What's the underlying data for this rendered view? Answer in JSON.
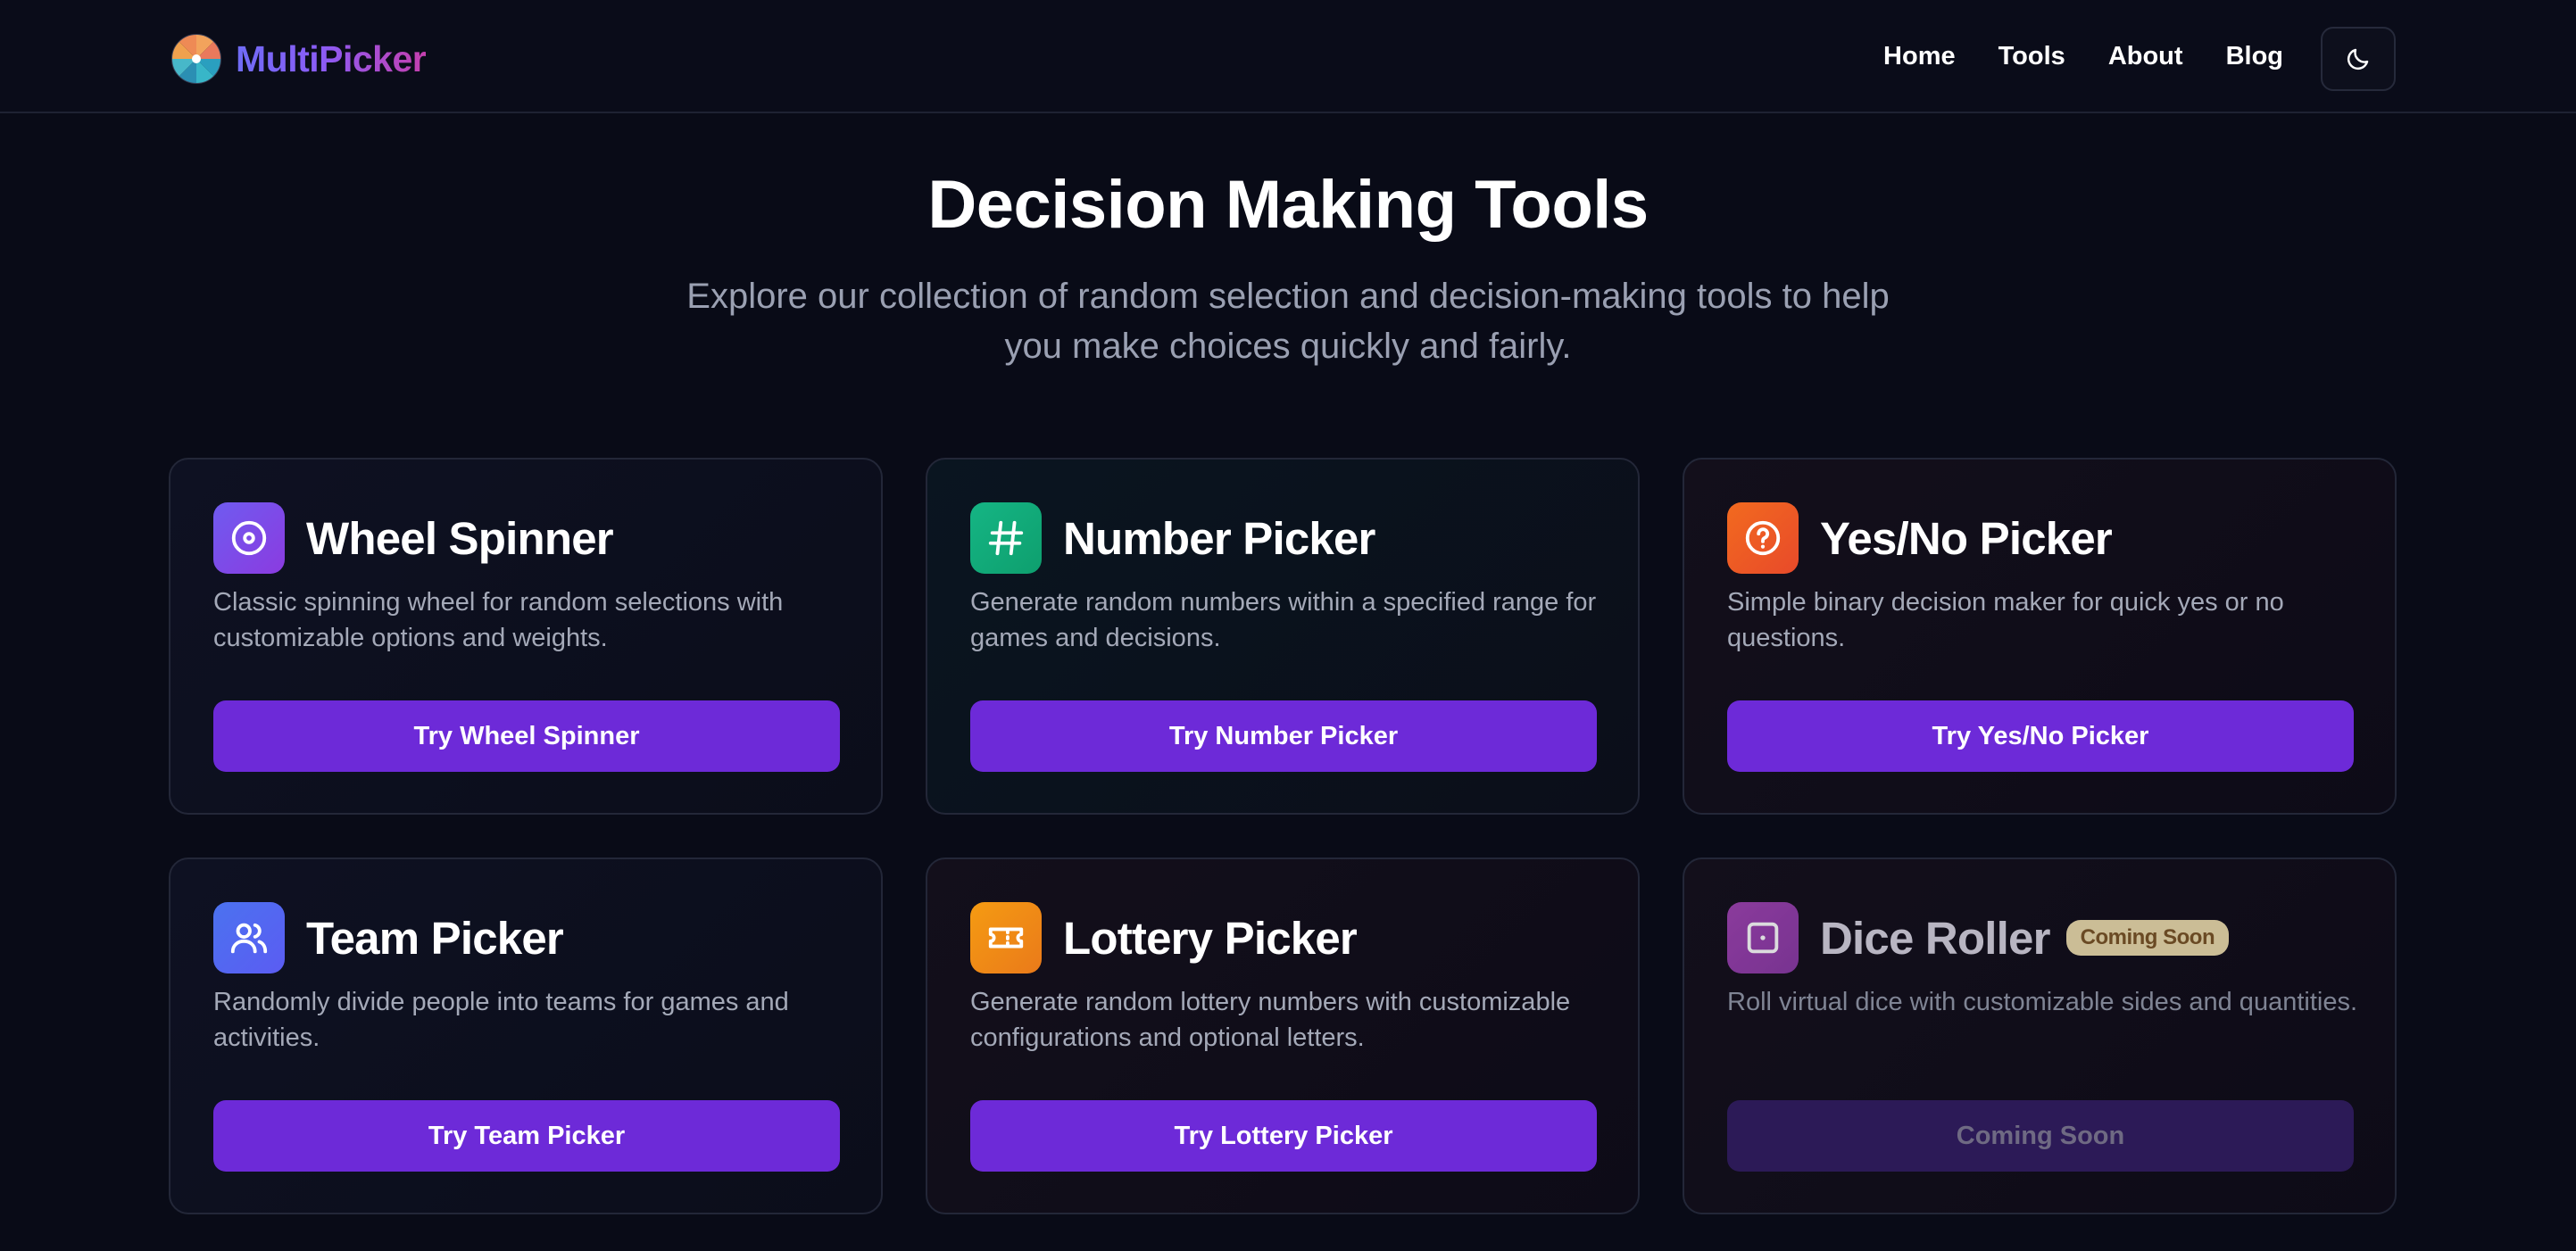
{
  "brand": {
    "name": "MultiPicker",
    "logo_icon": "pinwheel-logo-icon"
  },
  "nav": {
    "items": [
      "Home",
      "Tools",
      "About",
      "Blog"
    ],
    "theme_toggle_icon": "moon-icon"
  },
  "hero": {
    "title": "Decision Making Tools",
    "subtitle": "Explore our collection of random selection and decision-making tools to help you make choices quickly and fairly."
  },
  "colors": {
    "button": "#6d2ad8",
    "background": "#090b17",
    "badge": "#cbbd96"
  },
  "tools": [
    {
      "title": "Wheel Spinner",
      "icon": "target-circle-icon",
      "icon_color": "#7c3aed",
      "description": "Classic spinning wheel for random selections with customizable options and weights.",
      "button": "Try Wheel Spinner"
    },
    {
      "title": "Number Picker",
      "icon": "hash-icon",
      "icon_color": "#10b981",
      "description": "Generate random numbers within a specified range for games and decisions.",
      "button": "Try Number Picker"
    },
    {
      "title": "Yes/No Picker",
      "icon": "question-circle-icon",
      "icon_color": "#f05a22",
      "description": "Simple binary decision maker for quick yes or no questions.",
      "button": "Try Yes/No Picker"
    },
    {
      "title": "Team Picker",
      "icon": "users-icon",
      "icon_color": "#4f6df2",
      "description": "Randomly divide people into teams for games and activities.",
      "button": "Try Team Picker"
    },
    {
      "title": "Lottery Picker",
      "icon": "ticket-icon",
      "icon_color": "#f08c16",
      "description": "Generate random lottery numbers with customizable configurations and optional letters.",
      "button": "Try Lottery Picker"
    },
    {
      "title": "Dice Roller",
      "icon": "dice-icon",
      "icon_color": "#9b3fae",
      "badge": "Coming Soon",
      "description": "Roll virtual dice with customizable sides and quantities.",
      "button": "Coming Soon"
    }
  ]
}
